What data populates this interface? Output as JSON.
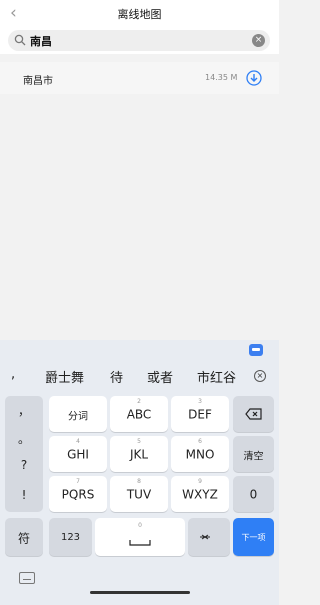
{
  "header": {
    "back_icon": "chevron-left-icon",
    "title": "离线地图"
  },
  "search": {
    "query": "南昌",
    "search_icon": "search-icon",
    "clear_icon": "clear-icon"
  },
  "results": [
    {
      "name": "南昌市",
      "size": "14.35 M",
      "action_icon": "download-icon"
    }
  ],
  "keyboard": {
    "candidates": [
      ",",
      "爵士舞",
      "待",
      "或者",
      "市红谷"
    ],
    "side_punct": [
      "，",
      "。",
      "?",
      "!"
    ],
    "keys": {
      "fenci": "分词",
      "k2": {
        "num": "2",
        "label": "ABC"
      },
      "k3": {
        "num": "3",
        "label": "DEF"
      },
      "k4": {
        "num": "4",
        "label": "GHI"
      },
      "k5": {
        "num": "5",
        "label": "JKL"
      },
      "k6": {
        "num": "6",
        "label": "MNO"
      },
      "k7": {
        "num": "7",
        "label": "PQRS"
      },
      "k8": {
        "num": "8",
        "label": "TUV"
      },
      "k9": {
        "num": "9",
        "label": "WXYZ"
      },
      "clear": "清空",
      "zero": "0",
      "fu": "符",
      "n123": "123",
      "space_num": "0",
      "next": "下一项"
    }
  },
  "colors": {
    "accent": "#2f7ff5",
    "keyboard_bg": "#e8ecf2"
  }
}
